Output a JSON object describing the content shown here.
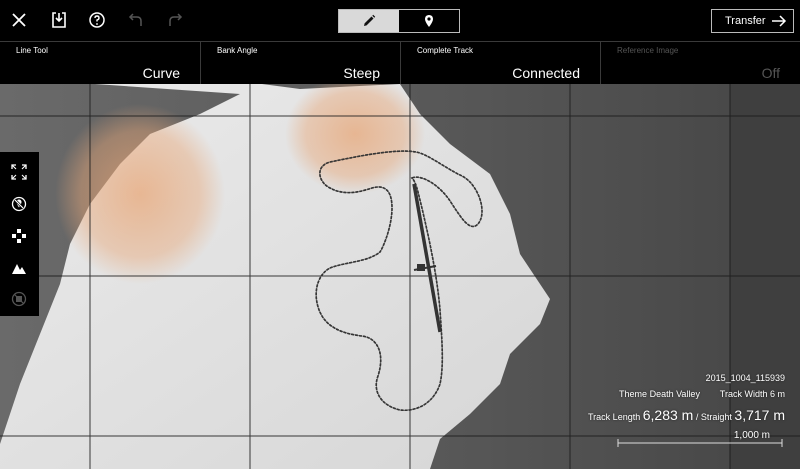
{
  "toolbar": {
    "icons": [
      "close-icon",
      "save-icon",
      "help-icon",
      "undo-icon",
      "redo-icon"
    ],
    "mode_icons": [
      "pencil-icon",
      "location-pin-icon"
    ],
    "active_mode": "pencil-icon",
    "transfer_label": "Transfer"
  },
  "settings": [
    {
      "label": "Line Tool",
      "value": "Curve",
      "enabled": true
    },
    {
      "label": "Bank Angle",
      "value": "Steep",
      "enabled": true
    },
    {
      "label": "Complete Track",
      "value": "Connected",
      "enabled": true
    },
    {
      "label": "Reference Image",
      "value": "Off",
      "enabled": false
    }
  ],
  "side_tools": [
    "fit-view-icon",
    "no-pin-icon",
    "dpad-icon",
    "terrain-icon",
    "disabled-layer-icon"
  ],
  "info": {
    "file_name": "2015_1004_115939",
    "theme_label": "Theme",
    "theme_value": "Death Valley",
    "width_label": "Track Width",
    "width_value": "6 m",
    "length_label": "Track Length",
    "length_value": "6,283 m",
    "straight_label": "Straight",
    "straight_value": "3,717 m",
    "scale_label": "1,000 m"
  },
  "colors": {
    "ui_background": "#000000",
    "terrain_light": "#e4e4e4",
    "terrain_dark": "#4d4d4d",
    "dune_overlay": "#e8a778",
    "grid_line": "#1a1a1a",
    "track_line": "#222222"
  }
}
